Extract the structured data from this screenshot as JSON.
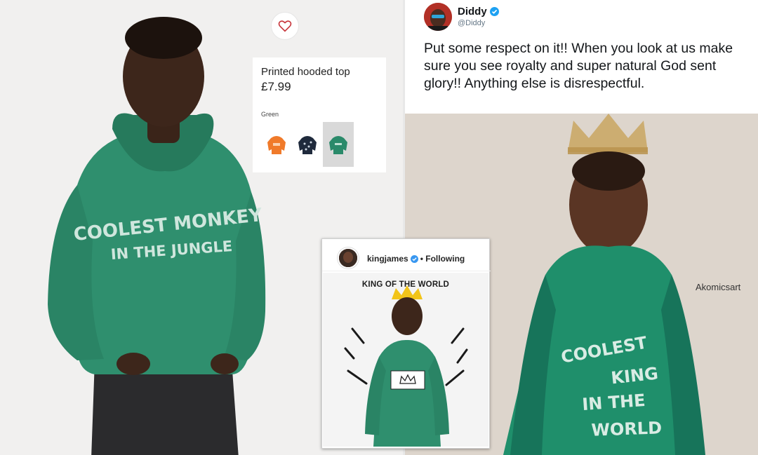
{
  "product": {
    "name": "Printed hooded top",
    "price": "£7.99",
    "color_label": "Green",
    "hoodie_print": [
      "COOLEST MONKEY",
      "IN THE JUNGLE"
    ],
    "swatches": [
      {
        "icon": "orange-hoodie-thumbnail",
        "color": "#f07a2a"
      },
      {
        "icon": "navy-print-hoodie-thumbnail",
        "color": "#1f2a3c"
      },
      {
        "icon": "green-hoodie-thumbnail",
        "color": "#2a8a6a"
      }
    ],
    "favorite_icon": "heart-outline-icon",
    "accent": "#c8373d",
    "hoodie_color": "#2f8f6e"
  },
  "tweet": {
    "name": "Diddy",
    "handle": "@Diddy",
    "verified_icon": "verified-badge-icon",
    "text": "Put some respect on it!! When you look at us make sure you see royalty and super natural God sent glory!! Anything else is disrespectful.",
    "verified_color": "#1da1f2"
  },
  "painting": {
    "credit": "Akomicsart",
    "hoodie_print": [
      "COOLEST",
      "KING",
      "IN THE",
      "WORLD"
    ]
  },
  "instagram": {
    "username": "kingjames",
    "follow_status": "• Following",
    "image_title": "KING OF THE WORLD"
  }
}
